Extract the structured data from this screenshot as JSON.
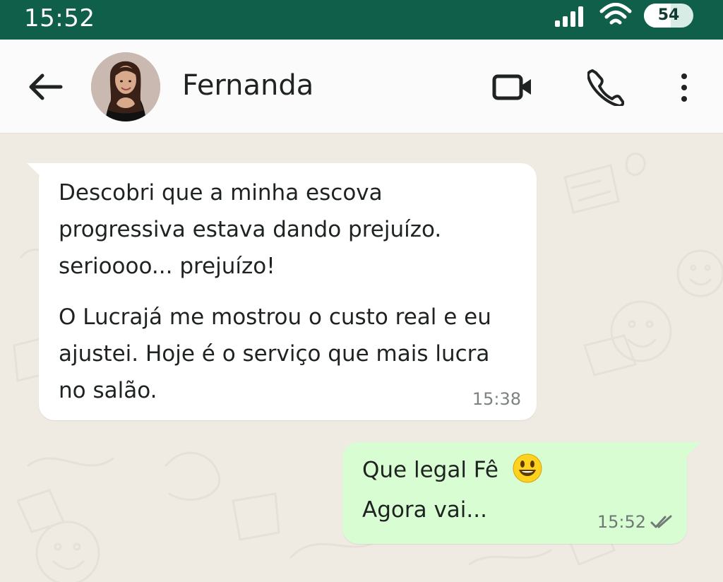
{
  "status_bar": {
    "time": "15:52",
    "battery_level": "54",
    "battery_fraction": 0.54
  },
  "header": {
    "contact_name": "Fernanda",
    "icons": [
      "back-arrow-icon",
      "avatar",
      "video-call-icon",
      "voice-call-icon",
      "more-options-icon"
    ]
  },
  "messages": [
    {
      "direction": "incoming",
      "paragraphs": [
        "Descobri que a minha escova progressiva estava dando prejuízo. serioooo... prejuízo!",
        "O Lucrajá me mostrou o custo real e eu ajustei. Hoje é o serviço que mais lucra no salão."
      ],
      "time": "15:38"
    },
    {
      "direction": "outgoing",
      "lines": [
        "Que legal Fê",
        "Agora vai..."
      ],
      "emoji": "grinning-face",
      "time": "15:52",
      "status": "read"
    }
  ],
  "colors": {
    "status_bar": "#0f5f4a",
    "chat_background": "#efeae2",
    "incoming_bubble": "#ffffff",
    "outgoing_bubble": "#d9fdd3",
    "read_checks": "#707b78"
  }
}
